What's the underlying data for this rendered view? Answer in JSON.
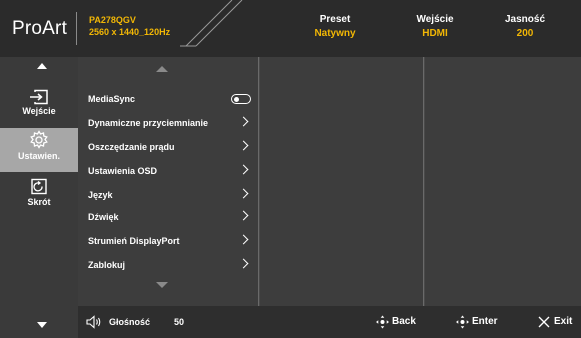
{
  "header": {
    "logo": "ProArt",
    "model": "PA278QGV",
    "resolution": "2560 x 1440_120Hz",
    "preset": {
      "label": "Preset",
      "value": "Natywny"
    },
    "input": {
      "label": "Wejście",
      "value": "HDMI"
    },
    "brightness": {
      "label": "Jasność",
      "value": "200"
    }
  },
  "sidebar": {
    "items": [
      {
        "label": "Wejście",
        "icon": "input-icon",
        "active": false
      },
      {
        "label": "Ustawien.",
        "icon": "gear-icon",
        "active": true
      },
      {
        "label": "Skrót",
        "icon": "shortcut-icon",
        "active": false
      }
    ]
  },
  "menu": {
    "items": [
      {
        "label": "MediaSync",
        "control": "toggle",
        "toggle_on": false
      },
      {
        "label": "Dynamiczne przyciemnianie",
        "control": "chevron"
      },
      {
        "label": "Oszczędzanie prądu",
        "control": "chevron"
      },
      {
        "label": "Ustawienia OSD",
        "control": "chevron"
      },
      {
        "label": "Język",
        "control": "chevron"
      },
      {
        "label": "Dźwięk",
        "control": "chevron"
      },
      {
        "label": "Strumień DisplayPort",
        "control": "chevron"
      },
      {
        "label": "Zablokuj",
        "control": "chevron"
      }
    ]
  },
  "footer": {
    "volume_label": "Głośność",
    "volume_value": "50",
    "back_label": "Back",
    "enter_label": "Enter",
    "exit_label": "Exit"
  },
  "colors": {
    "accent": "#f2b705",
    "header_bg": "#2b2b2b",
    "panel_bg": "#3d3d3d",
    "sidebar_active": "#a7a7a7"
  }
}
